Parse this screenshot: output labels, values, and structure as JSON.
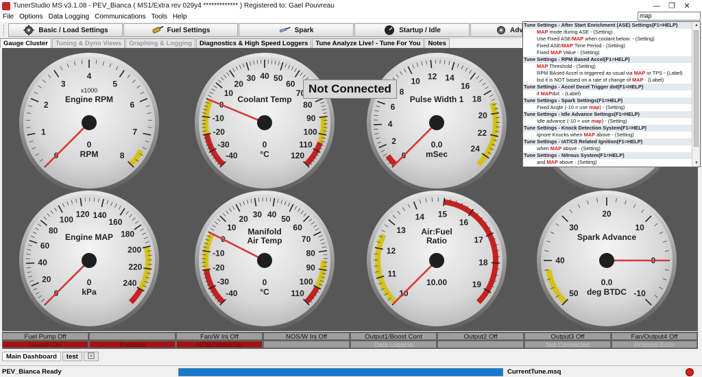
{
  "window": {
    "title": "TunerStudio MS v3.1.08 - PEV_Bianca ( MS1/Extra rev 029y4 ************* ) Registered to: Gael Pouvreau",
    "minimize_glyph": "—",
    "maximize_glyph": "❐",
    "close_glyph": "✕"
  },
  "menu": [
    "File",
    "Options",
    "Data Logging",
    "Communications",
    "Tools",
    "Help"
  ],
  "search": {
    "value": "map"
  },
  "toolbar": [
    {
      "label": "Basic / Load Settings",
      "icon": "gear-icon"
    },
    {
      "label": "Fuel Settings",
      "icon": "injector-icon"
    },
    {
      "label": "Spark",
      "icon": "spark-plug-icon"
    },
    {
      "label": "Startup / Idle",
      "icon": "gauge-dial-icon"
    },
    {
      "label": "Adva",
      "icon": "gear-icon"
    }
  ],
  "tabs": [
    {
      "label": "Gauge Cluster",
      "state": "active"
    },
    {
      "label": "Tuning & Dyno Views",
      "state": "disabled"
    },
    {
      "label": "Graphing & Logging",
      "state": "disabled"
    },
    {
      "label": "Diagnostics & High Speed Loggers",
      "state": "normal"
    },
    {
      "label": "Tune Analyze Live! - Tune For You",
      "state": "normal"
    },
    {
      "label": "Notes",
      "state": "normal"
    }
  ],
  "not_connected": "Not Connected",
  "gauges": [
    {
      "title": "Engine RPM",
      "subtitle": "x1000",
      "value": "0",
      "units": "RPM",
      "ticks": [
        "0",
        "1",
        "2",
        "3",
        "4",
        "5",
        "6",
        "7",
        "8"
      ],
      "min": 0,
      "max": 8,
      "current": 0,
      "bands": [
        {
          "from": 7.5,
          "to": 8,
          "color": "#d4c21a"
        }
      ]
    },
    {
      "title": "Coolant Temp",
      "value": "0",
      "units": "°C",
      "ticks": [
        "-40",
        "-30",
        "-20",
        "-10",
        "0",
        "10",
        "20",
        "30",
        "40",
        "50",
        "60",
        "70",
        "80",
        "90",
        "100",
        "110",
        "120"
      ],
      "min": -40,
      "max": 120,
      "current": 0,
      "bands": [
        {
          "from": -40,
          "to": -20,
          "color": "#c92020"
        },
        {
          "from": -20,
          "to": 0,
          "color": "#d4c21a"
        },
        {
          "from": 90,
          "to": 105,
          "color": "#d4c21a"
        },
        {
          "from": 105,
          "to": 120,
          "color": "#c92020"
        }
      ]
    },
    {
      "title": "Pulse Width 1",
      "value": "0.0",
      "units": "mSec",
      "ticks": [
        "0",
        "2",
        "4",
        "6",
        "8",
        "10",
        "12",
        "14",
        "16",
        "18",
        "20",
        "22",
        "24"
      ],
      "min": 0,
      "max": 25,
      "current": 0,
      "bands": [
        {
          "from": 0,
          "to": 1,
          "color": "#c92020"
        },
        {
          "from": 19,
          "to": 25,
          "color": "#d4c21a"
        }
      ]
    },
    {
      "title": "",
      "value": "",
      "units": "",
      "ticks": [],
      "min": 0,
      "max": 10,
      "current": 0,
      "bands": []
    },
    {
      "title": "Engine MAP",
      "value": "0",
      "units": "kPa",
      "ticks": [
        "0",
        "20",
        "40",
        "60",
        "80",
        "100",
        "120",
        "140",
        "160",
        "180",
        "200",
        "220",
        "240"
      ],
      "min": 0,
      "max": 255,
      "current": 0,
      "bands": [
        {
          "from": 200,
          "to": 240,
          "color": "#d4c21a"
        },
        {
          "from": 240,
          "to": 255,
          "color": "#c92020"
        }
      ]
    },
    {
      "title": "Manifold\nAir Temp",
      "value": "0",
      "units": "°C",
      "ticks": [
        "-40",
        "-30",
        "-20",
        "-10",
        "0",
        "10",
        "20",
        "30",
        "40",
        "50",
        "60",
        "70",
        "80",
        "90",
        "100",
        "110"
      ],
      "min": -40,
      "max": 110,
      "current": 0,
      "bands": [
        {
          "from": -40,
          "to": -20,
          "color": "#c92020"
        },
        {
          "from": -20,
          "to": 0,
          "color": "#d4c21a"
        },
        {
          "from": 85,
          "to": 100,
          "color": "#d4c21a"
        },
        {
          "from": 100,
          "to": 110,
          "color": "#c92020"
        }
      ]
    },
    {
      "title": "Air:Fuel\nRatio",
      "value": "10.00",
      "units": "",
      "ticks": [
        "10",
        "11",
        "12",
        "13",
        "14",
        "15",
        "16",
        "17",
        "18",
        "19"
      ],
      "min": 10,
      "max": 19.5,
      "current": 10,
      "bands": [
        {
          "from": 10,
          "to": 12.5,
          "color": "#d4c21a"
        },
        {
          "from": 15,
          "to": 19.5,
          "color": "#c92020"
        }
      ]
    },
    {
      "title": "Spark Advance",
      "value": "0.0",
      "units": "deg BTDC",
      "ticks": [
        "50",
        "40",
        "30",
        "20",
        "10",
        "0",
        "-10"
      ],
      "min": 50,
      "max": -10,
      "current": 0,
      "bands": [
        {
          "from": 50,
          "to": 42,
          "color": "#d4c21a"
        }
      ]
    }
  ],
  "search_results": [
    {
      "type": "hdr",
      "text": "Tune Settings - After Start Enrichment (ASE) Settings(F1=HELP)"
    },
    {
      "type": "item",
      "pre": "",
      "hl": "MAP",
      "post": " mode during ASE - (Setting)"
    },
    {
      "type": "item",
      "pre": "Use Fixed ASE/",
      "hl": "MAP",
      "post": " when coolant below: - (Setting)"
    },
    {
      "type": "item",
      "pre": "Fixed ASE/",
      "hl": "MAP",
      "post": " Time Period - (Setting)"
    },
    {
      "type": "item",
      "pre": "Fixed ",
      "hl": "MAP",
      "post": " Value - (Setting)"
    },
    {
      "type": "hdr",
      "text": "Tune Settings - RPM Based Accel(F1=HELP)"
    },
    {
      "type": "item",
      "pre": "",
      "hl": "MAP",
      "post": " Threshold - (Setting)"
    },
    {
      "type": "item",
      "pre": "RPM BAsed Accel is triggered as usual via ",
      "hl": "MAP",
      "post": " or TPS - (Label)"
    },
    {
      "type": "item",
      "pre": "but it is NOT based on a rate of change of ",
      "hl": "MAP",
      "post": " - (Label)"
    },
    {
      "type": "hdr",
      "text": "Tune Settings - Accel Decel Trigger dot(F1=HELP)"
    },
    {
      "type": "item",
      "pre": "if ",
      "hl": "MAP",
      "post": "dot: - (Label)"
    },
    {
      "type": "hdr",
      "text": "Tune Settings - Spark Settings(F1=HELP)"
    },
    {
      "type": "item",
      "pre": "Fixed Angle (-10 = use ",
      "hl": "map",
      "post": ") - (Setting)"
    },
    {
      "type": "hdr",
      "text": "Tune Settings - Idle Advance Settings(F1=HELP)"
    },
    {
      "type": "item",
      "pre": "Idle advance (-10 = use ",
      "hl": "map",
      "post": ") - (Setting)"
    },
    {
      "type": "hdr",
      "text": "Tune Settings - Knock Detection System(F1=HELP)"
    },
    {
      "type": "item",
      "pre": "ignore Knocks when ",
      "hl": "MAP",
      "post": " above - (Setting)"
    },
    {
      "type": "hdr",
      "text": "Tune Settings - IAT/Clt Related Ignition(F1=HELP)"
    },
    {
      "type": "item",
      "pre": "when ",
      "hl": "MAP",
      "post": " above - (Setting)"
    },
    {
      "type": "hdr",
      "text": "Tune Settings - Nitrous System(F1=HELP)"
    },
    {
      "type": "item",
      "pre": "and ",
      "hl": "MAP",
      "post": " above - (Setting)"
    }
  ],
  "indicators": [
    [
      {
        "label": "Fuel Pump Off",
        "style": "off"
      },
      {
        "label": "",
        "style": "off"
      },
      {
        "label": "Fan/W Inj Off",
        "style": "off"
      },
      {
        "label": "NOS/W Inj Off",
        "style": "off"
      },
      {
        "label": "Output1/Boost Cont",
        "style": "off"
      },
      {
        "label": "Output2 Off",
        "style": "off"
      },
      {
        "label": "Output3 Off",
        "style": "off"
      },
      {
        "label": "Fan/Output4 Off",
        "style": "off"
      }
    ],
    [
      {
        "label": "Launch On",
        "style": "red"
      },
      {
        "label": "Knocked",
        "style": "red"
      },
      {
        "label": "NOS/Tables On",
        "style": "red"
      },
      {
        "label": "",
        "style": "off"
      },
      {
        "label": "Data Logging",
        "style": "dim"
      },
      {
        "label": "",
        "style": "off"
      },
      {
        "label": "Not Connected",
        "style": "dim"
      },
      {
        "label": "Protocol Error",
        "style": "dim"
      }
    ]
  ],
  "bottom_tabs": [
    {
      "label": "Main Dashboard",
      "state": "active"
    },
    {
      "label": "test",
      "state": "normal"
    }
  ],
  "status": {
    "left": "PEV_Bianca Ready",
    "file": "CurrentTune.msq",
    "progress": 1.0,
    "progress_color": "#0f7bd6"
  }
}
